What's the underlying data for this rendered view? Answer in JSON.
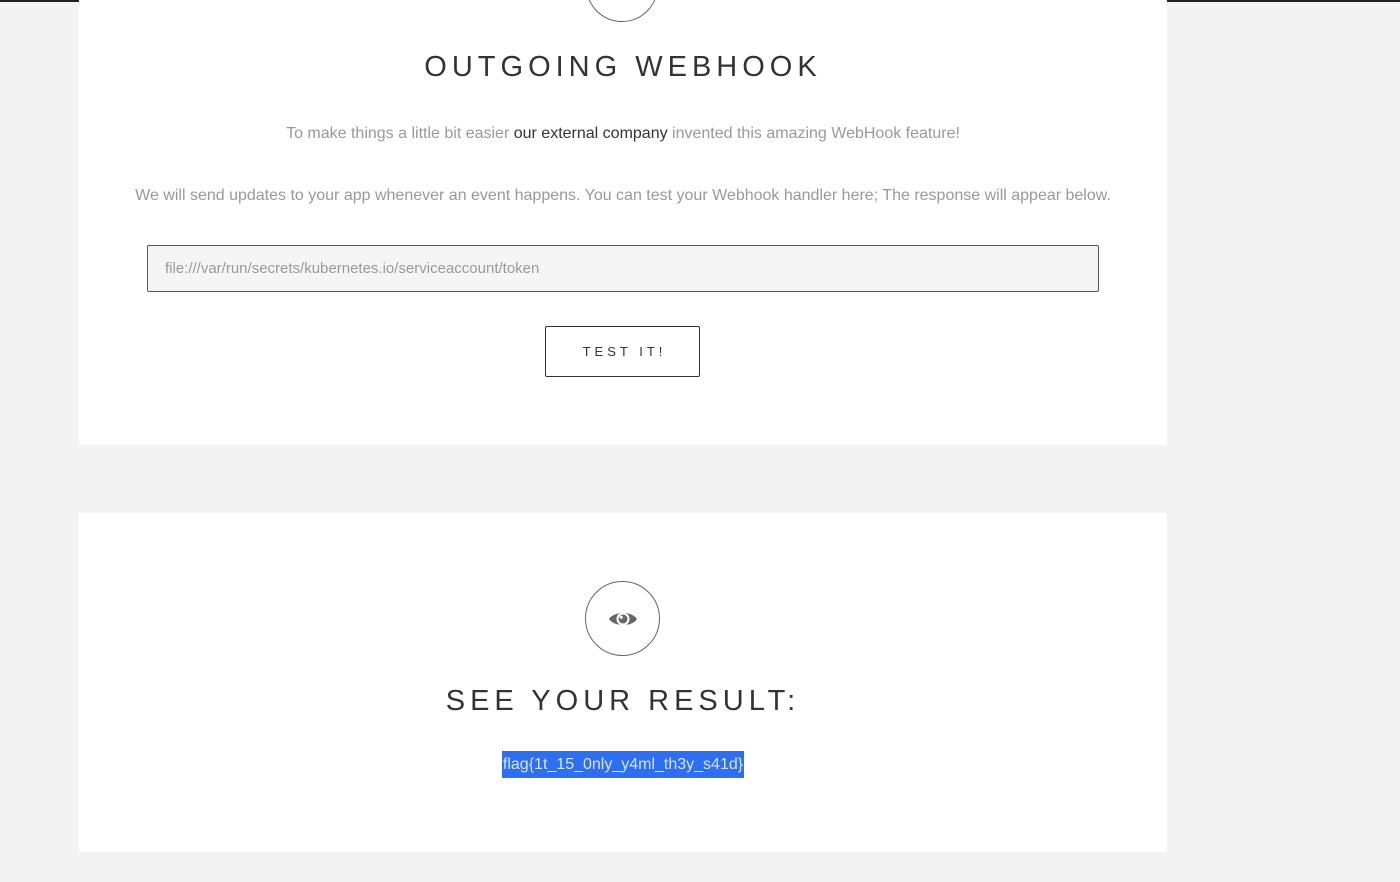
{
  "webhook": {
    "title": "OUTGOING WEBHOOK",
    "intro_before": "To make things a little bit easier",
    "intro_link": "our external company",
    "intro_after": "invented this amazing WebHook feature!",
    "description": "We will send updates to your app whenever an event happens. You can test your Webhook handler here; The response will appear below.",
    "url_value": "file:///var/run/secrets/kubernetes.io/serviceaccount/token",
    "test_button_label": "TEST IT!"
  },
  "result": {
    "icon": "eye-icon",
    "title": "SEE YOUR RESULT:",
    "value": "flag{1t_15_0nly_y4ml_th3y_s41d}"
  },
  "colors": {
    "page_background": "#f3f3f3",
    "card_background": "#ffffff",
    "selection_highlight": "#2d6ff0",
    "heading_text": "#333333",
    "muted_text": "#999999"
  }
}
